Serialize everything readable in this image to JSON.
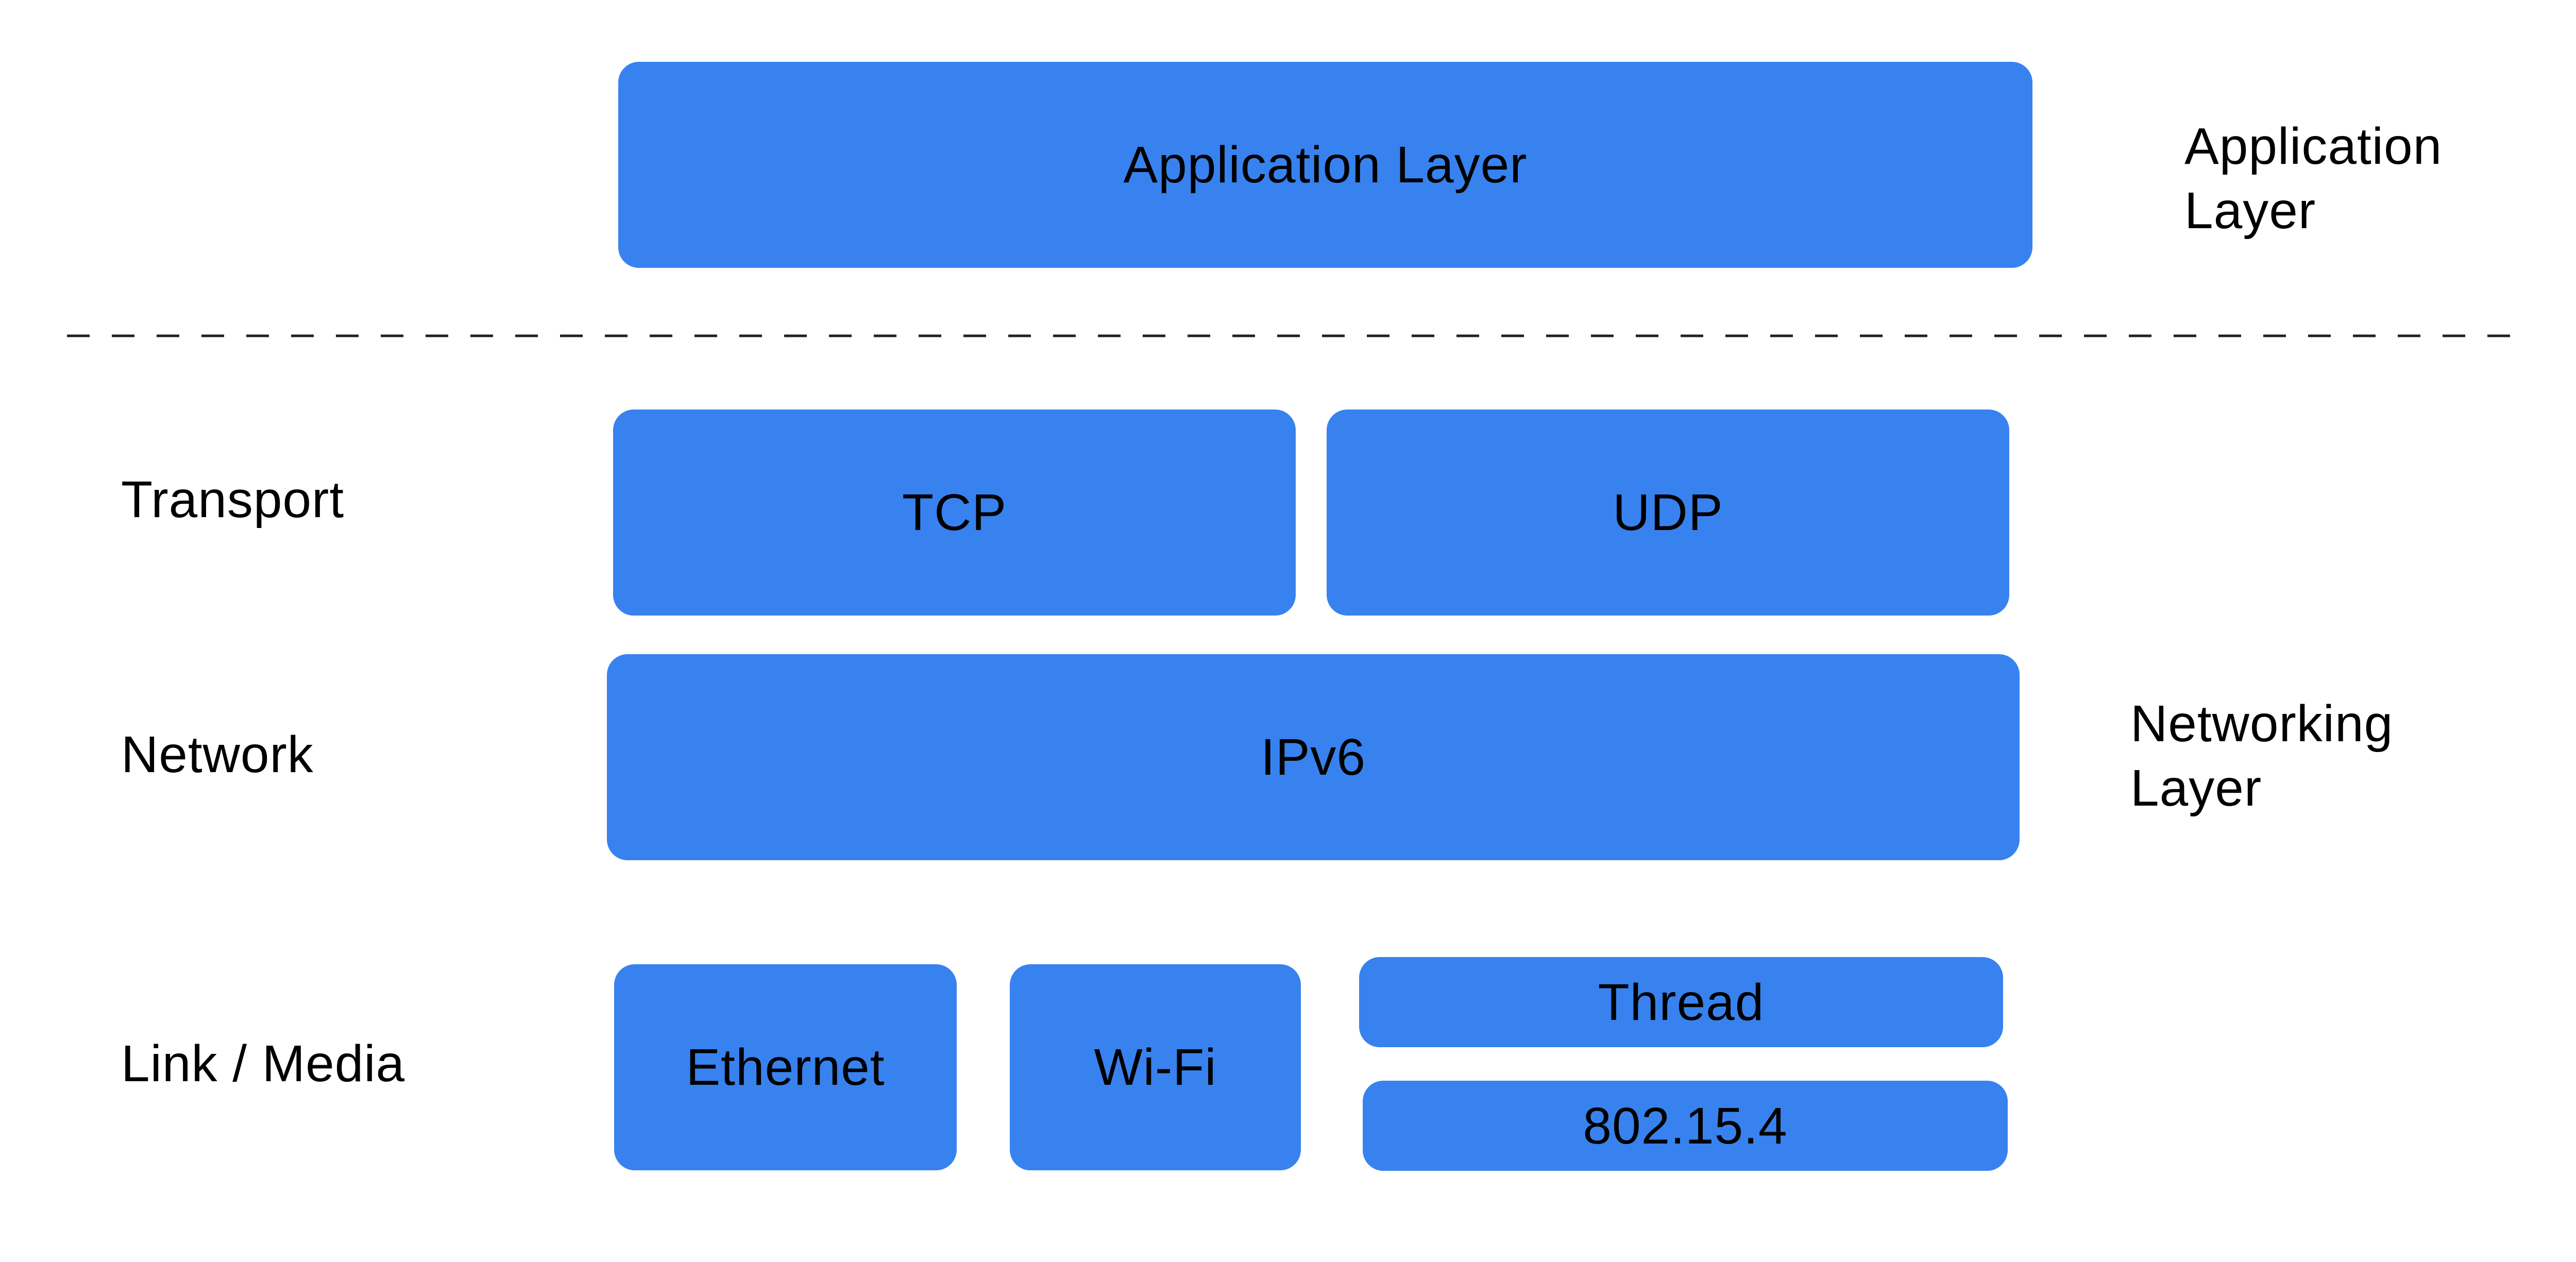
{
  "colors": {
    "box_fill": "#3782EF",
    "divider": "#231F20",
    "text": "#000000",
    "background": "#FFFFFF"
  },
  "top": {
    "application_box": "Application Layer",
    "side_label": "Application\nLayer"
  },
  "rows": {
    "transport": {
      "label": "Transport",
      "boxes": [
        "TCP",
        "UDP"
      ]
    },
    "network": {
      "label": "Network",
      "boxes": [
        "IPv6"
      ]
    },
    "link": {
      "label": "Link / Media",
      "boxes": [
        "Ethernet",
        "Wi-Fi",
        "Thread",
        "802.15.4"
      ]
    }
  },
  "networking_side_label": "Networking\nLayer"
}
